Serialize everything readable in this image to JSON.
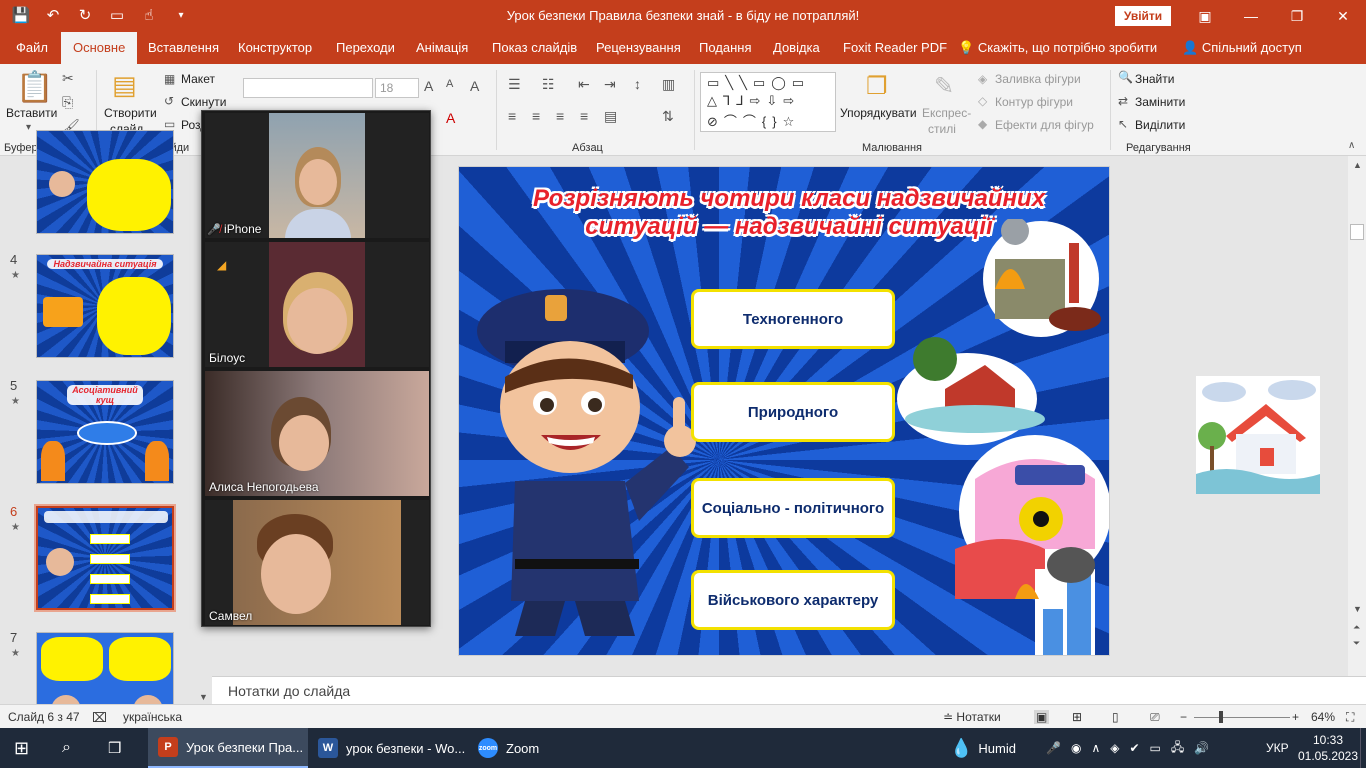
{
  "window": {
    "title": "Урок безпеки Правила безпеки знай - в біду не потрапляй!",
    "signin_label": "Увійти"
  },
  "tabs": [
    "Файл",
    "Основне",
    "Вставлення",
    "Конструктор",
    "Переходи",
    "Анімація",
    "Показ слайдів",
    "Рецензування",
    "Подання",
    "Довідка",
    "Foxit Reader PDF"
  ],
  "tellme": "Скажіть, що потрібно зробити",
  "share_label": "Спільний доступ",
  "ribbon": {
    "paste_label": "Вставити",
    "clipboard_group": "Буфер обміну",
    "new_slide_label_1": "Створити",
    "new_slide_label_2": "слайд",
    "layout_label": "Макет",
    "reset_label": "Скинути",
    "section_label": "Розд",
    "slides_group": "Слайди",
    "font_size": "18",
    "paragraph_group": "Абзац",
    "arrange_label": "Упорядкувати",
    "quick_styles_1": "Експрес-",
    "quick_styles_2": "стилі",
    "shape_fill": "Заливка фігури",
    "shape_outline": "Контур фігури",
    "shape_effects": "Ефекти для фігур",
    "drawing_group": "Малювання",
    "find_label": "Знайти",
    "replace_label": "Замінити",
    "select_label": "Виділити",
    "editing_group": "Редагування"
  },
  "thumbnails": [
    {
      "num": "",
      "title": ""
    },
    {
      "num": "4",
      "title": "Надзвичайна ситуація"
    },
    {
      "num": "5",
      "title": "Асоціативний кущ"
    },
    {
      "num": "6",
      "title": ""
    },
    {
      "num": "7",
      "title": ""
    }
  ],
  "zoom": {
    "participants": [
      {
        "name": "iPhone"
      },
      {
        "name": "Білоус"
      },
      {
        "name": "Алиса Непогодьева"
      },
      {
        "name": "Самвел"
      }
    ]
  },
  "slide": {
    "title": "Розрізняють чотири класи надзвичайних ситуацій — надзвичайні ситуації",
    "options": [
      "Техногенного",
      "Природного",
      "Соціально - політичного",
      "Військового характеру"
    ]
  },
  "notes_placeholder": "Нотатки до слайда",
  "status": {
    "slide_of": "Слайд 6 з 47",
    "language": "українська",
    "notes_label": "Нотатки",
    "zoom_level": "64%"
  },
  "taskbar": {
    "items": [
      "Урок безпеки Пра...",
      "урок безпеки - Wo...",
      "Zoom"
    ],
    "weather": "Humid",
    "lang": "УКР",
    "time": "10:33",
    "date": "01.05.2023"
  }
}
